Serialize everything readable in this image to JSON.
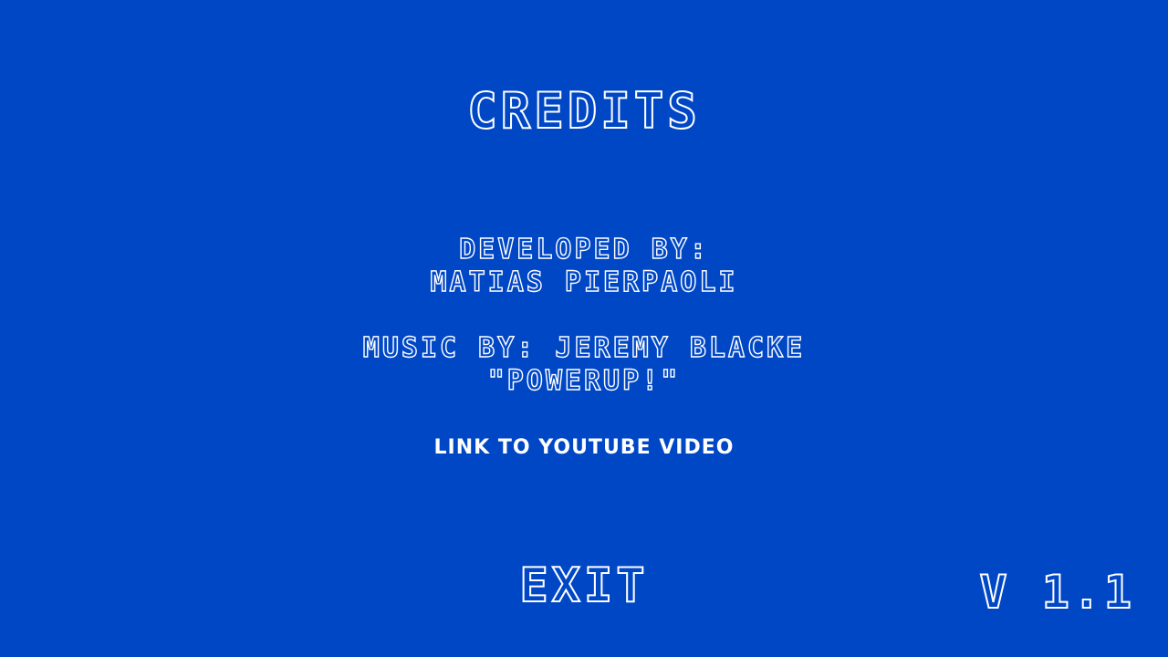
{
  "title": "CREDITS",
  "credits": {
    "developed_label": "DEVELOPED BY:",
    "developer_name": "MATIAS PIERPAOLI",
    "music_label": "MUSIC BY: JEREMY BLACKE",
    "music_track": "\"POWERUP!\""
  },
  "link": {
    "label": "LINK TO YOUTUBE VIDEO"
  },
  "exit_label": "EXIT",
  "version": "V 1.1",
  "colors": {
    "background": "#0047c6",
    "text": "#ffffff"
  }
}
